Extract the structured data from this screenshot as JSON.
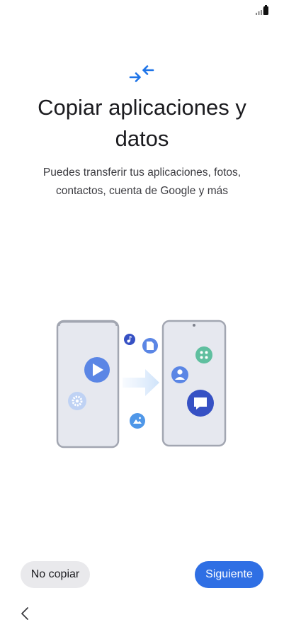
{
  "header": {
    "title": "Copiar aplicaciones y datos",
    "subtitle": "Puedes transferir tus aplicaciones, fotos, contactos, cuenta de Google y más"
  },
  "actions": {
    "skip_label": "No copiar",
    "next_label": "Siguiente"
  },
  "icons": {
    "header": "transfer-arrows-icon",
    "back": "chevron-left-icon"
  },
  "colors": {
    "accent": "#2f6fe4",
    "header_icon": "#1e74e8",
    "secondary_button": "#e9e9ec",
    "play_bubble": "#5b86e5",
    "chat_bubble": "#3651c4",
    "apps_bubble": "#5fbf9f"
  }
}
